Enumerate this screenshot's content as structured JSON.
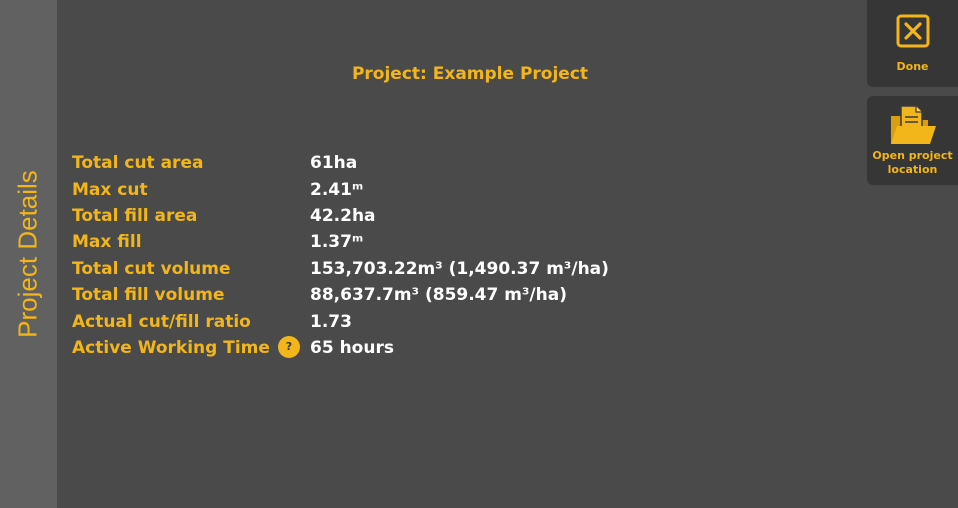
{
  "sidebar": {
    "title": "Project Details"
  },
  "header": {
    "title": "Project: Example Project"
  },
  "details": [
    {
      "label": "Total cut area",
      "value": "61ha"
    },
    {
      "label": "Max cut",
      "value": "2.41ᵐ"
    },
    {
      "label": "Total fill area",
      "value": "42.2ha"
    },
    {
      "label": "Max fill",
      "value": "1.37ᵐ"
    },
    {
      "label": "Total cut volume",
      "value": "153,703.22m³ (1,490.37 m³/ha)"
    },
    {
      "label": "Total fill volume",
      "value": "88,637.7m³ (859.47 m³/ha)"
    },
    {
      "label": "Actual cut/fill ratio",
      "value": "1.73"
    },
    {
      "label": "Active Working Time",
      "value": "65 hours",
      "help": "?"
    }
  ],
  "toolbar": {
    "done_label": "Done",
    "open_label_line1": "Open project",
    "open_label_line2": "location",
    "done_icon": "close-box-icon",
    "open_icon": "folder-document-icon"
  },
  "colors": {
    "accent": "#f2b61a",
    "background": "#4a4a4a",
    "sidebar": "#616161",
    "button": "#363636",
    "value_text": "#ffffff"
  }
}
